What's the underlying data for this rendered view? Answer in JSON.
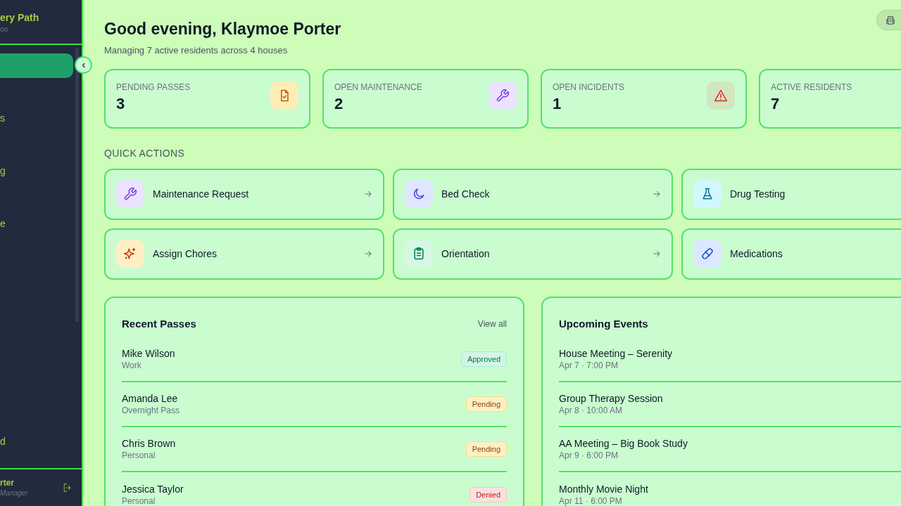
{
  "sidebar": {
    "brand": "ery Path",
    "brand_subtitle": "os",
    "nav_items": [
      {
        "selected": true
      },
      {
        "label": "s",
        "selected": false
      },
      {
        "label": "g",
        "selected": false
      },
      {
        "label": "e",
        "selected": false
      }
    ],
    "bottom_items": [
      {
        "label": "d",
        "selected": false
      }
    ],
    "user": {
      "name": "rter",
      "role": "Manager"
    }
  },
  "header": {
    "greeting": "Good evening, Klaymoe Porter",
    "subtitle": "Managing 7 active residents across 4 houses"
  },
  "stats": [
    {
      "label": "PENDING PASSES",
      "value": "3"
    },
    {
      "label": "OPEN MAINTENANCE",
      "value": "2"
    },
    {
      "label": "OPEN INCIDENTS",
      "value": "1"
    },
    {
      "label": "ACTIVE RESIDENTS",
      "value": "7"
    }
  ],
  "quick_actions": {
    "title": "QUICK ACTIONS",
    "items": [
      {
        "label": "Maintenance Request"
      },
      {
        "label": "Bed Check"
      },
      {
        "label": "Drug Testing"
      },
      {
        "label": "Assign Chores"
      },
      {
        "label": "Orientation"
      },
      {
        "label": "Medications"
      }
    ]
  },
  "recent_passes": {
    "title": "Recent Passes",
    "link": "View all",
    "rows": [
      {
        "name": "Mike Wilson",
        "type": "Work",
        "status": "Approved",
        "kind": "approved"
      },
      {
        "name": "Amanda Lee",
        "type": "Overnight Pass",
        "status": "Pending",
        "kind": "pending"
      },
      {
        "name": "Chris Brown",
        "type": "Personal",
        "status": "Pending",
        "kind": "pending"
      },
      {
        "name": "Jessica Taylor",
        "type": "Personal",
        "status": "Denied",
        "kind": "denied"
      }
    ]
  },
  "upcoming_events": {
    "title": "Upcoming Events",
    "rows": [
      {
        "name": "House Meeting – Serenity",
        "when": "Apr 7 · 7:00 PM"
      },
      {
        "name": "Group Therapy Session",
        "when": "Apr 8 · 10:00 AM"
      },
      {
        "name": "AA Meeting – Big Book Study",
        "when": "Apr 9 · 6:00 PM"
      },
      {
        "name": "Monthly Movie Night",
        "when": "Apr 11 · 6:00 PM"
      }
    ]
  }
}
